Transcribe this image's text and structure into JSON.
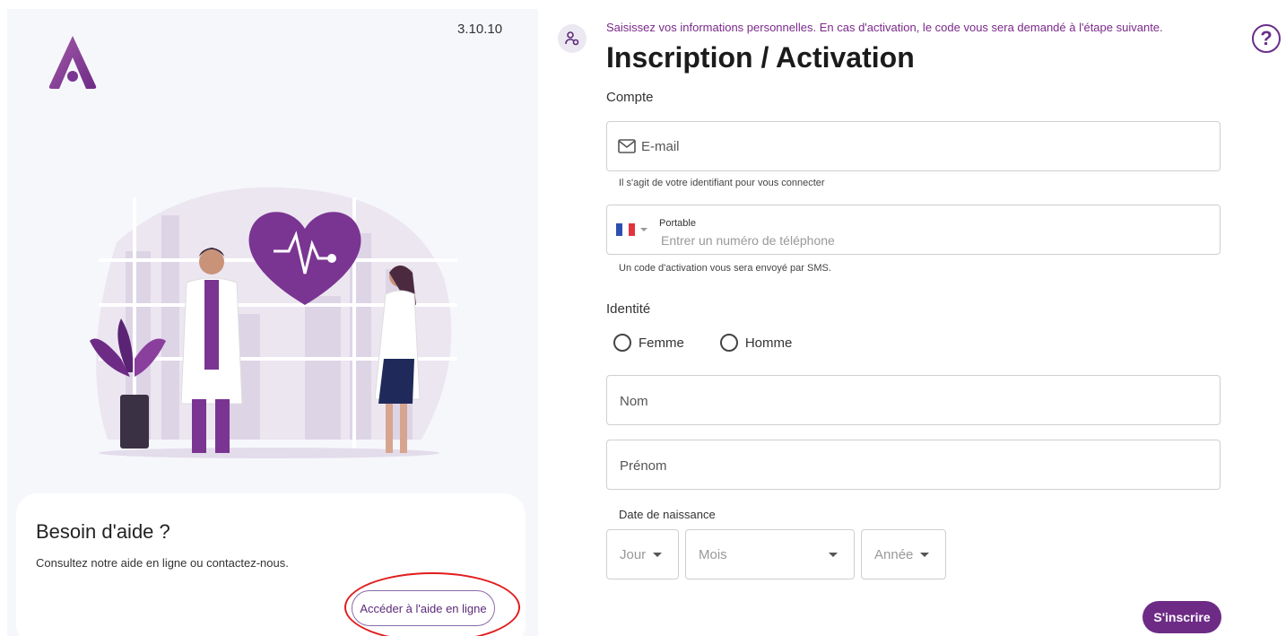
{
  "app": {
    "version": "3.10.10"
  },
  "help": {
    "title": "Besoin d'aide ?",
    "text": "Consultez notre aide en ligne ou contactez-nous.",
    "button_label": "Accéder à l'aide en ligne"
  },
  "form": {
    "info": "Saisissez vos informations personnelles. En cas d'activation, le code vous sera demandé à l'étape suivante.",
    "title": "Inscription / Activation",
    "help_symbol": "?",
    "account_section": "Compte",
    "email": {
      "label": "E-mail",
      "hint": "Il s'agit de votre identifiant pour vous connecter"
    },
    "phone": {
      "label": "Portable",
      "placeholder": "Entrer un numéro de téléphone",
      "hint": "Un code d'activation vous sera envoyé par SMS."
    },
    "identity_section": "Identité",
    "gender_options": [
      "Femme",
      "Homme"
    ],
    "last_name": "Nom",
    "first_name": "Prénom",
    "birthdate": {
      "label": "Date de naissance",
      "day": "Jour",
      "month": "Mois",
      "year": "Année"
    },
    "submit_label": "S'inscrire"
  },
  "colors": {
    "accent": "#6d2b86",
    "info_text": "#7b2a8b",
    "annotation": "#e11d1d"
  }
}
